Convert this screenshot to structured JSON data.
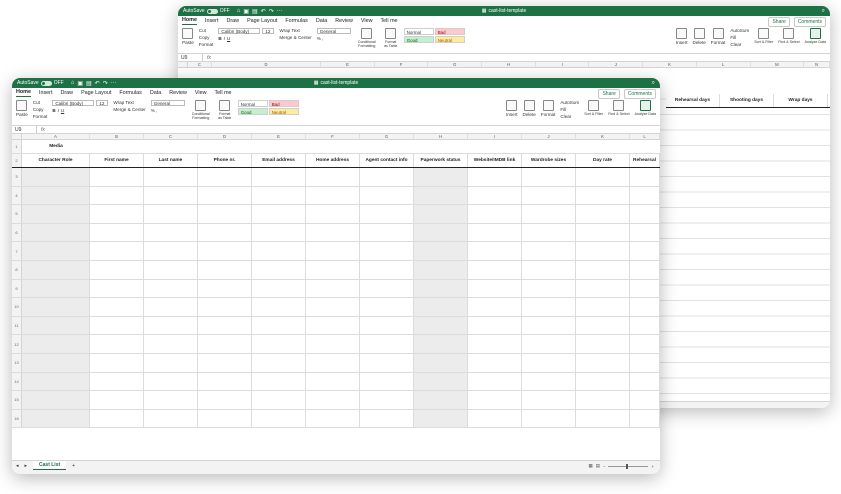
{
  "app": {
    "autosave_label": "AutoSave",
    "autosave_state": "OFF",
    "doc_title": "cast-list-template",
    "accent": "#1e7145"
  },
  "tabs": [
    "Home",
    "Insert",
    "Draw",
    "Page Layout",
    "Formulas",
    "Data",
    "Review",
    "View",
    "Tell me"
  ],
  "share": {
    "share_label": "Share",
    "comments_label": "Comments"
  },
  "ribbon": {
    "paste": "Paste",
    "cut": "Cut",
    "copy": "Copy",
    "format": "Format",
    "font_name": "Calibri (Body)",
    "font_size": "12",
    "wrap_text": "Wrap Text",
    "merge_center": "Merge & Center",
    "number_format": "General",
    "conditional_formatting": "Conditional Formatting",
    "format_as_table": "Format as Table",
    "styles": {
      "normal": "Normal",
      "bad": "Bad",
      "good": "Good",
      "neutral": "Neutral"
    },
    "insert": "Insert",
    "delete": "Delete",
    "format_cells": "Format",
    "autosum": "AutoSum",
    "fill": "Fill",
    "clear": "Clear",
    "sort_filter": "Sort & Filter",
    "find_select": "Find & Select",
    "analyze_data": "Analyze Data"
  },
  "formula_bar": {
    "name_box": "U9",
    "fx": "fx"
  },
  "back_window": {
    "columns": [
      "C",
      "D",
      "E",
      "F",
      "G",
      "H",
      "I",
      "J",
      "K",
      "L",
      "M",
      "N"
    ],
    "headers": [
      "Rehearsal days",
      "Shooting days",
      "Wrap days"
    ]
  },
  "front_window": {
    "columns": [
      "A",
      "B",
      "C",
      "D",
      "E",
      "F",
      "G",
      "H",
      "I",
      "J",
      "K",
      "L"
    ],
    "title_cell": "Media",
    "headers": [
      "Character Role",
      "First name",
      "Last name",
      "Phone nr.",
      "Email address",
      "Home address",
      "Agent contact info",
      "Paperwork status",
      "Website/IMDB link",
      "Wardrobe sizes",
      "Day rate",
      "Rehearsal"
    ],
    "row_numbers": [
      "1",
      "2",
      "3",
      "4",
      "5",
      "6",
      "7",
      "8",
      "9",
      "10",
      "11",
      "12",
      "13",
      "14",
      "15",
      "16"
    ],
    "sheet_tab": "Cast List",
    "add_sheet": "+"
  }
}
